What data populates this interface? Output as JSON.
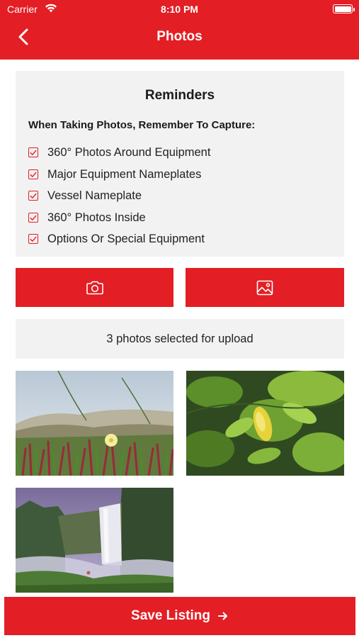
{
  "status_bar": {
    "carrier": "Carrier",
    "time": "8:10 PM"
  },
  "header": {
    "title": "Photos",
    "back_icon": "chevron-left-icon"
  },
  "reminders": {
    "title": "Reminders",
    "subtitle": "When Taking Photos, Remember To Capture:",
    "items": [
      {
        "label": "360° Photos Around Equipment",
        "checked": true
      },
      {
        "label": "Major Equipment Nameplates",
        "checked": true
      },
      {
        "label": "Vessel Nameplate",
        "checked": true
      },
      {
        "label": "360° Photos Inside",
        "checked": true
      },
      {
        "label": "Options Or Special Equipment",
        "checked": true
      }
    ]
  },
  "actions": {
    "camera_icon": "camera-icon",
    "gallery_icon": "image-gallery-icon"
  },
  "selection": {
    "status": "3 photos selected for upload"
  },
  "photos": [
    {
      "name": "dune-flowers-photo"
    },
    {
      "name": "lemon-leaves-photo"
    },
    {
      "name": "waterfall-photo"
    }
  ],
  "footer": {
    "save_label": "Save Listing",
    "arrow_icon": "arrow-right-icon"
  },
  "colors": {
    "accent": "#e31e24",
    "panel": "#f2f2f2"
  }
}
